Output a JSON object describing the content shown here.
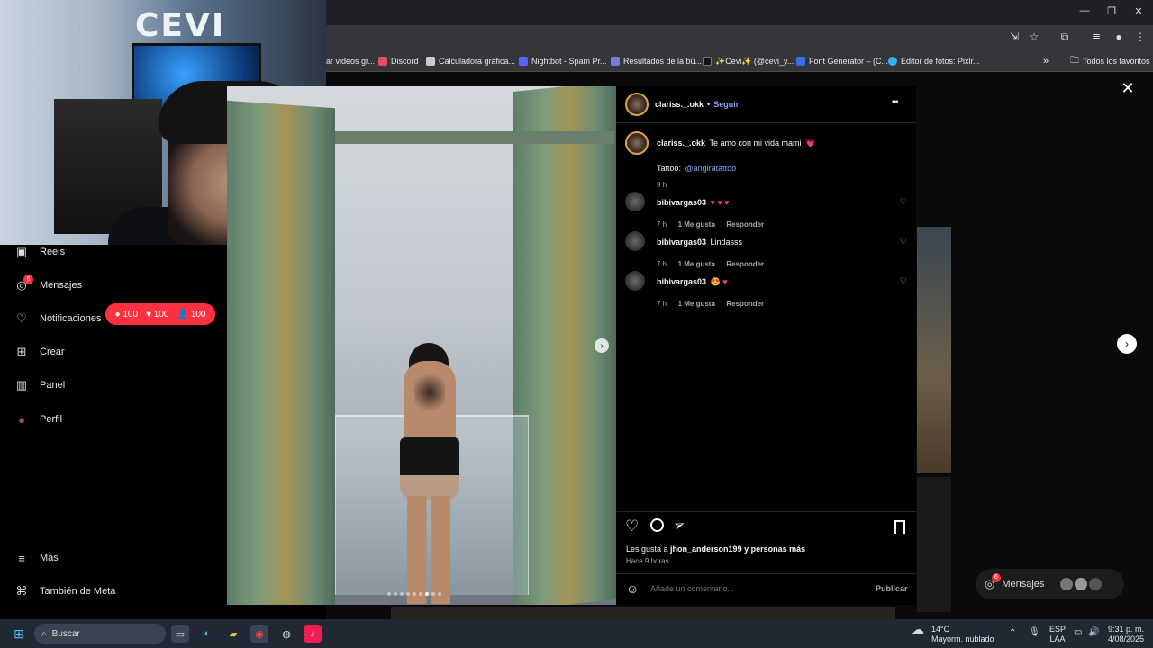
{
  "browser": {
    "bookmarks": [
      {
        "label": "ar videos gr...",
        "color": "#888888"
      },
      {
        "label": "Discord",
        "color": "#e84b5a"
      },
      {
        "label": "Calculadora gráfica...",
        "color": "#cccccc"
      },
      {
        "label": "Nightbot - Spam Pr...",
        "color": "#5865f2"
      },
      {
        "label": "Resultados de la bú...",
        "color": "#7a7ad8"
      },
      {
        "label": "✨Cevi✨ (@cevi_y...",
        "color": "#111111"
      },
      {
        "label": "Font Generator – (C...",
        "color": "#3a6ee8"
      },
      {
        "label": "Editor de fotos: Pixlr...",
        "color": "#33b3ee"
      }
    ],
    "overflow_label": "»",
    "favorites_label": "Todos los favoritos"
  },
  "webcam": {
    "sign_text": "CEVI"
  },
  "sidebar": {
    "items": [
      {
        "label": "Reels",
        "icon": "reels-icon",
        "glyph": "▣"
      },
      {
        "label": "Mensajes",
        "icon": "messenger-icon",
        "glyph": "◎"
      },
      {
        "label": "Notificaciones",
        "icon": "heart-icon",
        "glyph": "♡"
      },
      {
        "label": "Crear",
        "icon": "plus-square-icon",
        "glyph": "⊞"
      },
      {
        "label": "Panel",
        "icon": "chart-icon",
        "glyph": "▥"
      },
      {
        "label": "Perfil",
        "icon": "profile-avatar-icon",
        "glyph": "●"
      },
      {
        "label": "Más",
        "icon": "menu-icon",
        "glyph": "≡"
      },
      {
        "label": "También de Meta",
        "icon": "meta-icon",
        "glyph": "⌘"
      }
    ],
    "messages_badge": "6",
    "notif_badge": {
      "comments": "100",
      "likes": "100",
      "follows": "100"
    }
  },
  "post": {
    "author": "clariss._.okk",
    "separator": "•",
    "follow_label": "Seguir",
    "more_label": "•••",
    "caption_user": "clariss._.okk",
    "caption_text": "Te amo con mi vida mami",
    "caption_emoji": "💗",
    "tattoo_label": "Tattoo:",
    "tattoo_handle": "@angiratattoo",
    "caption_time": "9 h",
    "comments": [
      {
        "user": "bibivargas03",
        "text": "",
        "emoji": "♥ ♥ ♥",
        "time": "7 h",
        "likes": "1 Me gusta",
        "reply": "Responder"
      },
      {
        "user": "bibivargas03",
        "text": "Lindasss",
        "emoji": "",
        "time": "7 h",
        "likes": "1 Me gusta",
        "reply": "Responder"
      },
      {
        "user": "bibivargas03",
        "text": "",
        "emoji": "😍 ♥",
        "time": "7 h",
        "likes": "1 Me gusta",
        "reply": "Responder"
      }
    ],
    "likes_prefix": "Les gusta a ",
    "likes_user": "jhon_anderson199",
    "likes_suffix": " y personas más",
    "posted_ago": "Hace 9 horas",
    "comment_placeholder": "Añade un comentario...",
    "publish_label": "Publicar",
    "carousel_count": 9,
    "carousel_active": 6
  },
  "overlay": {
    "close_label": "✕",
    "next_label": "›"
  },
  "messages_pill": {
    "label": "Mensajes",
    "badge": "6"
  },
  "taskbar": {
    "search_label": "Buscar",
    "weather_temp": "14°C",
    "weather_desc": "Mayorm. nublado",
    "lang_1": "ESP",
    "lang_2": "LAA",
    "time": "9:31 p. m.",
    "date": "4/08/2025"
  }
}
